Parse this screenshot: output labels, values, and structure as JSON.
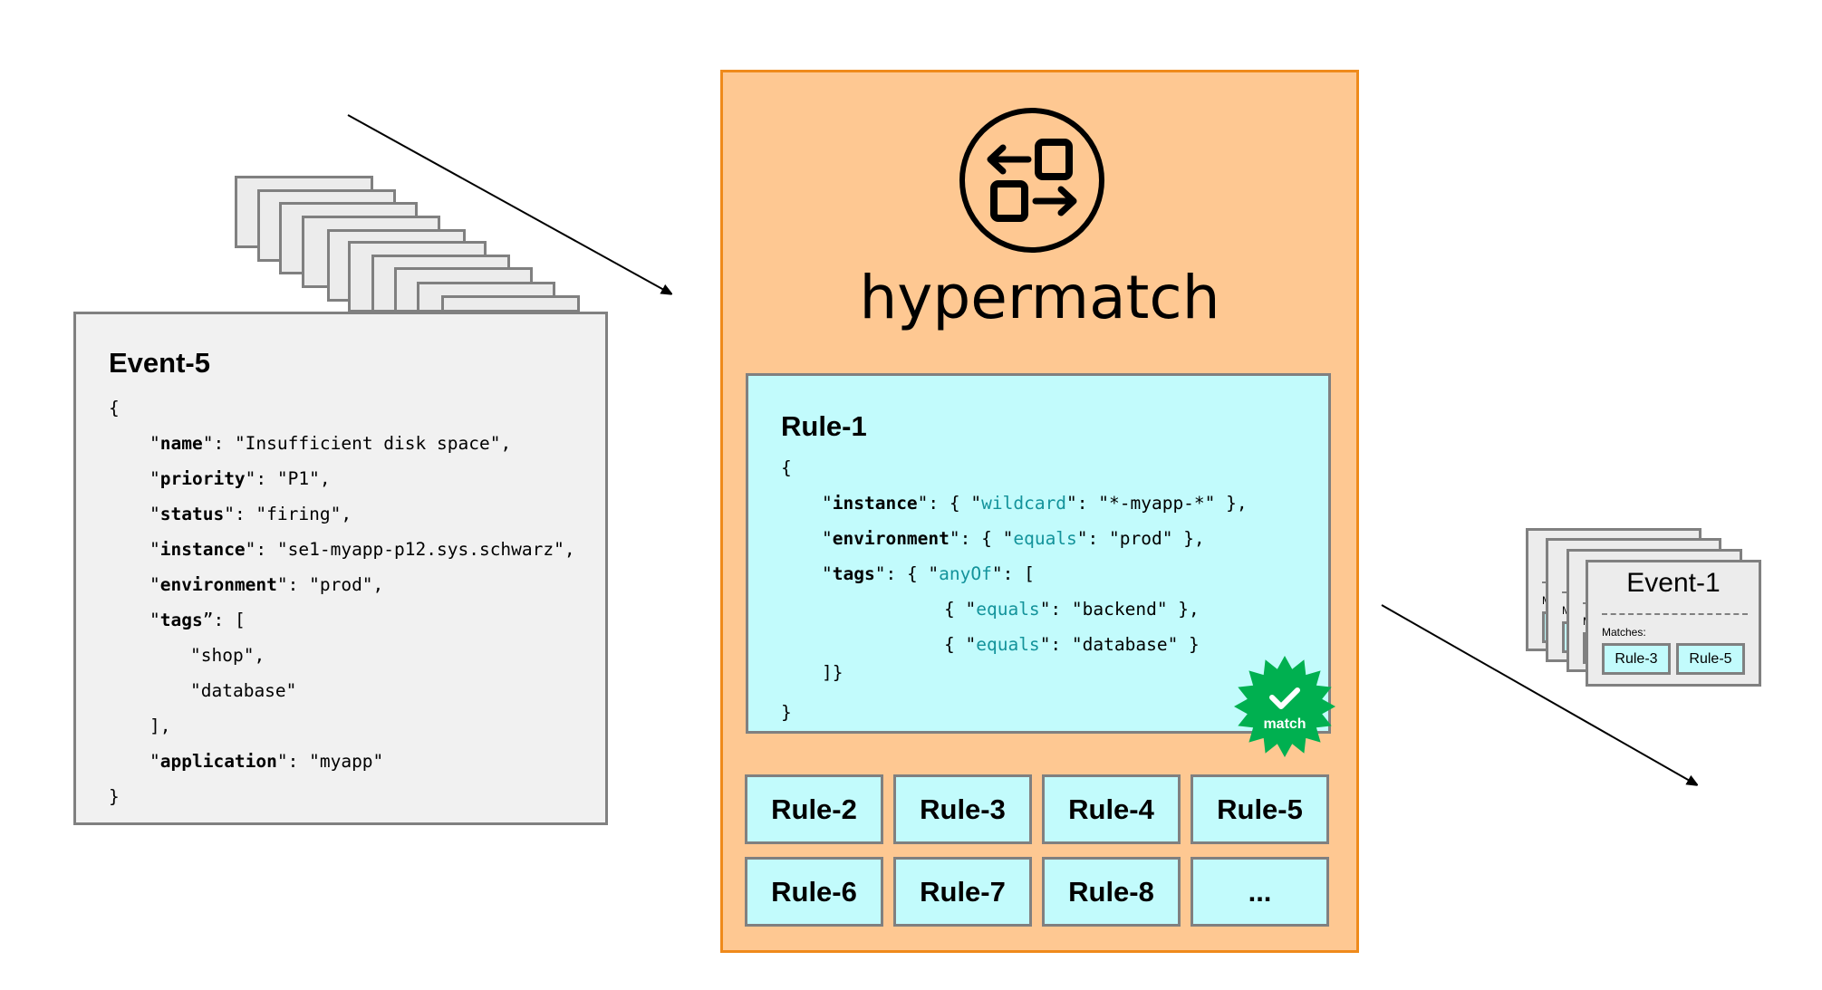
{
  "input_event": {
    "title": "Event-5",
    "stack_count": 10,
    "lines": [
      {
        "indent": 0,
        "parts": [
          {
            "t": "{"
          }
        ]
      },
      {
        "indent": 1,
        "parts": [
          {
            "t": "\""
          },
          {
            "t": "name",
            "b": true
          },
          {
            "t": "\": \"Insufficient disk space\","
          }
        ]
      },
      {
        "indent": 1,
        "parts": [
          {
            "t": "\""
          },
          {
            "t": "priority",
            "b": true
          },
          {
            "t": "\": \"P1\","
          }
        ]
      },
      {
        "indent": 1,
        "parts": [
          {
            "t": "\""
          },
          {
            "t": "status",
            "b": true
          },
          {
            "t": "\": \"firing\","
          }
        ]
      },
      {
        "indent": 1,
        "parts": [
          {
            "t": "\""
          },
          {
            "t": "instance",
            "b": true
          },
          {
            "t": "\": \"se1-myapp-p12.sys.schwarz\","
          }
        ]
      },
      {
        "indent": 1,
        "parts": [
          {
            "t": "\""
          },
          {
            "t": "environment",
            "b": true
          },
          {
            "t": "\": \"prod\","
          }
        ]
      },
      {
        "indent": 1,
        "parts": [
          {
            "t": "\""
          },
          {
            "t": "tags",
            "b": true
          },
          {
            "t": "”: ["
          }
        ]
      },
      {
        "indent": 2,
        "parts": [
          {
            "t": "\"shop\","
          }
        ]
      },
      {
        "indent": 2,
        "parts": [
          {
            "t": "\"database\""
          }
        ]
      },
      {
        "indent": 1,
        "parts": [
          {
            "t": "],"
          }
        ]
      },
      {
        "indent": 1,
        "parts": [
          {
            "t": "\""
          },
          {
            "t": "application",
            "b": true
          },
          {
            "t": "\": \"myapp\""
          }
        ]
      },
      {
        "indent": 0,
        "parts": [
          {
            "t": "}"
          }
        ]
      }
    ]
  },
  "engine": {
    "name": "hypermatch",
    "logo_icon": "swap-boxes-icon",
    "active_rule": {
      "title": "Rule-1",
      "lines": [
        {
          "indent": 0,
          "parts": [
            {
              "t": "{"
            }
          ]
        },
        {
          "indent": 1,
          "parts": [
            {
              "t": "\""
            },
            {
              "t": "instance",
              "b": true
            },
            {
              "t": "\": { \""
            },
            {
              "t": "wildcard",
              "o": true
            },
            {
              "t": "\": \"*-myapp-*\" },"
            }
          ]
        },
        {
          "indent": 1,
          "parts": [
            {
              "t": "\""
            },
            {
              "t": "environment",
              "b": true
            },
            {
              "t": "\": { \""
            },
            {
              "t": "equals",
              "o": true
            },
            {
              "t": "\": \"prod\" },"
            }
          ]
        },
        {
          "indent": 1,
          "parts": [
            {
              "t": "\""
            },
            {
              "t": "tags",
              "b": true
            },
            {
              "t": "\": { \""
            },
            {
              "t": "anyOf",
              "o": true
            },
            {
              "t": "\": ["
            }
          ]
        },
        {
          "indent": 4,
          "parts": [
            {
              "t": "{ \""
            },
            {
              "t": "equals",
              "o": true
            },
            {
              "t": "\": \"backend\" },"
            }
          ]
        },
        {
          "indent": 4,
          "parts": [
            {
              "t": "{ \""
            },
            {
              "t": "equals",
              "o": true
            },
            {
              "t": "\": \"database\" }"
            }
          ]
        },
        {
          "indent": 1,
          "parts": [
            {
              "t": "]}"
            }
          ]
        },
        {
          "indent": 0,
          "parts": [
            {
              "t": "}"
            }
          ]
        }
      ],
      "badge": {
        "label": "match",
        "icon": "checkmark-icon",
        "color": "#00b050"
      }
    },
    "other_rules": [
      "Rule-2",
      "Rule-3",
      "Rule-4",
      "Rule-5",
      "Rule-6",
      "Rule-7",
      "Rule-8",
      "..."
    ]
  },
  "output_event": {
    "title": "Event-1",
    "matches_label": "Matches:",
    "matched_rules": [
      "Rule-3",
      "Rule-5"
    ],
    "stack_count": 4
  },
  "colors": {
    "engine_bg": "#fec892",
    "engine_border": "#ef8a1b",
    "rule_bg": "#c2fbfc",
    "event_bg": "#f1f1f1",
    "operator": "#13939b",
    "match_badge": "#00b050"
  }
}
